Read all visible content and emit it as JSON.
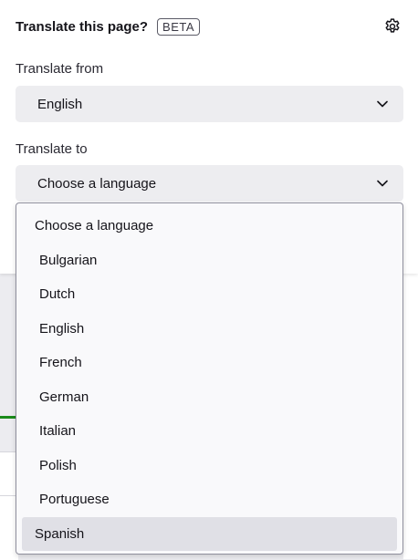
{
  "header": {
    "title": "Translate this page?",
    "badge": "BETA",
    "settings_icon": "gear-icon"
  },
  "from": {
    "label": "Translate from",
    "value": "English",
    "icon": "chevron-down-icon"
  },
  "to": {
    "label": "Translate to",
    "value": "Choose a language",
    "icon": "chevron-down-icon"
  },
  "dropdown": {
    "options": [
      "Choose a language",
      "Bulgarian",
      "Dutch",
      "English",
      "French",
      "German",
      "Italian",
      "Polish",
      "Portuguese",
      "Spanish"
    ],
    "highlighted": "Spanish"
  },
  "colors": {
    "panel": "#ffffff",
    "select_bg": "#ededf0",
    "dropdown_bg": "#f9f9fb",
    "highlight": "#e0e0e6"
  }
}
